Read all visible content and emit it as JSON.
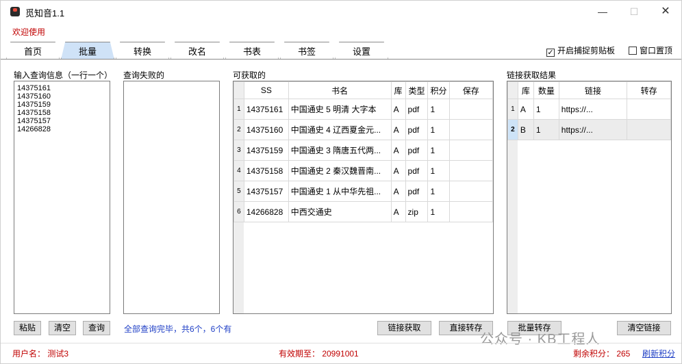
{
  "window": {
    "title": "觅知音1.1"
  },
  "welcome": "欢迎使用",
  "tabs": [
    "首页",
    "批量",
    "转换",
    "改名",
    "书表",
    "书签",
    "设置"
  ],
  "options": {
    "clipboard_label": "开启捕捉剪贴板",
    "clipboard_checked": "✓",
    "ontop_label": "窗口置顶"
  },
  "input_panel": {
    "label": "输入查询信息（一行一个）",
    "items": [
      "14375161",
      "14375160",
      "14375159",
      "14375158",
      "14375157",
      "14266828"
    ]
  },
  "failed_panel": {
    "label": "查询失败的"
  },
  "available": {
    "label": "可获取的",
    "columns": [
      "SS",
      "书名",
      "库",
      "类型",
      "积分",
      "保存"
    ],
    "rows": [
      {
        "num": "1",
        "ss": "14375161",
        "name": "中国通史  5  明清  大字本",
        "lib": "A",
        "type": "pdf",
        "score": "1",
        "save": ""
      },
      {
        "num": "2",
        "ss": "14375160",
        "name": "中国通史  4  辽西夏金元...",
        "lib": "A",
        "type": "pdf",
        "score": "1",
        "save": ""
      },
      {
        "num": "3",
        "ss": "14375159",
        "name": "中国通史  3  隋唐五代两...",
        "lib": "A",
        "type": "pdf",
        "score": "1",
        "save": ""
      },
      {
        "num": "4",
        "ss": "14375158",
        "name": "中国通史  2  秦汉魏晋南...",
        "lib": "A",
        "type": "pdf",
        "score": "1",
        "save": ""
      },
      {
        "num": "5",
        "ss": "14375157",
        "name": "中国通史  1  从中华先祖...",
        "lib": "A",
        "type": "pdf",
        "score": "1",
        "save": ""
      },
      {
        "num": "6",
        "ss": "14266828",
        "name": "中西交通史",
        "lib": "A",
        "type": "zip",
        "score": "1",
        "save": ""
      }
    ]
  },
  "links": {
    "label": "链接获取结果",
    "columns": [
      "库",
      "数量",
      "链接",
      "转存"
    ],
    "rows": [
      {
        "num": "1",
        "lib": "A",
        "count": "1",
        "link": "https://...",
        "save": ""
      },
      {
        "num": "2",
        "lib": "B",
        "count": "1",
        "link": "https://...",
        "save": ""
      }
    ]
  },
  "buttons": {
    "paste": "粘贴",
    "clear": "清空",
    "query": "查询",
    "get_link": "链接获取",
    "direct_save": "直接转存",
    "batch_save": "批量转存",
    "clear_links": "清空链接"
  },
  "status_message": "全部查询完毕，共6个，6个有",
  "statusbar": {
    "user": "用户名：  测试3",
    "expiry": "有效期至：  20991001",
    "points": "剩余积分：  265",
    "refresh": "刷新积分"
  },
  "watermark": "公众号 · KB工程人"
}
